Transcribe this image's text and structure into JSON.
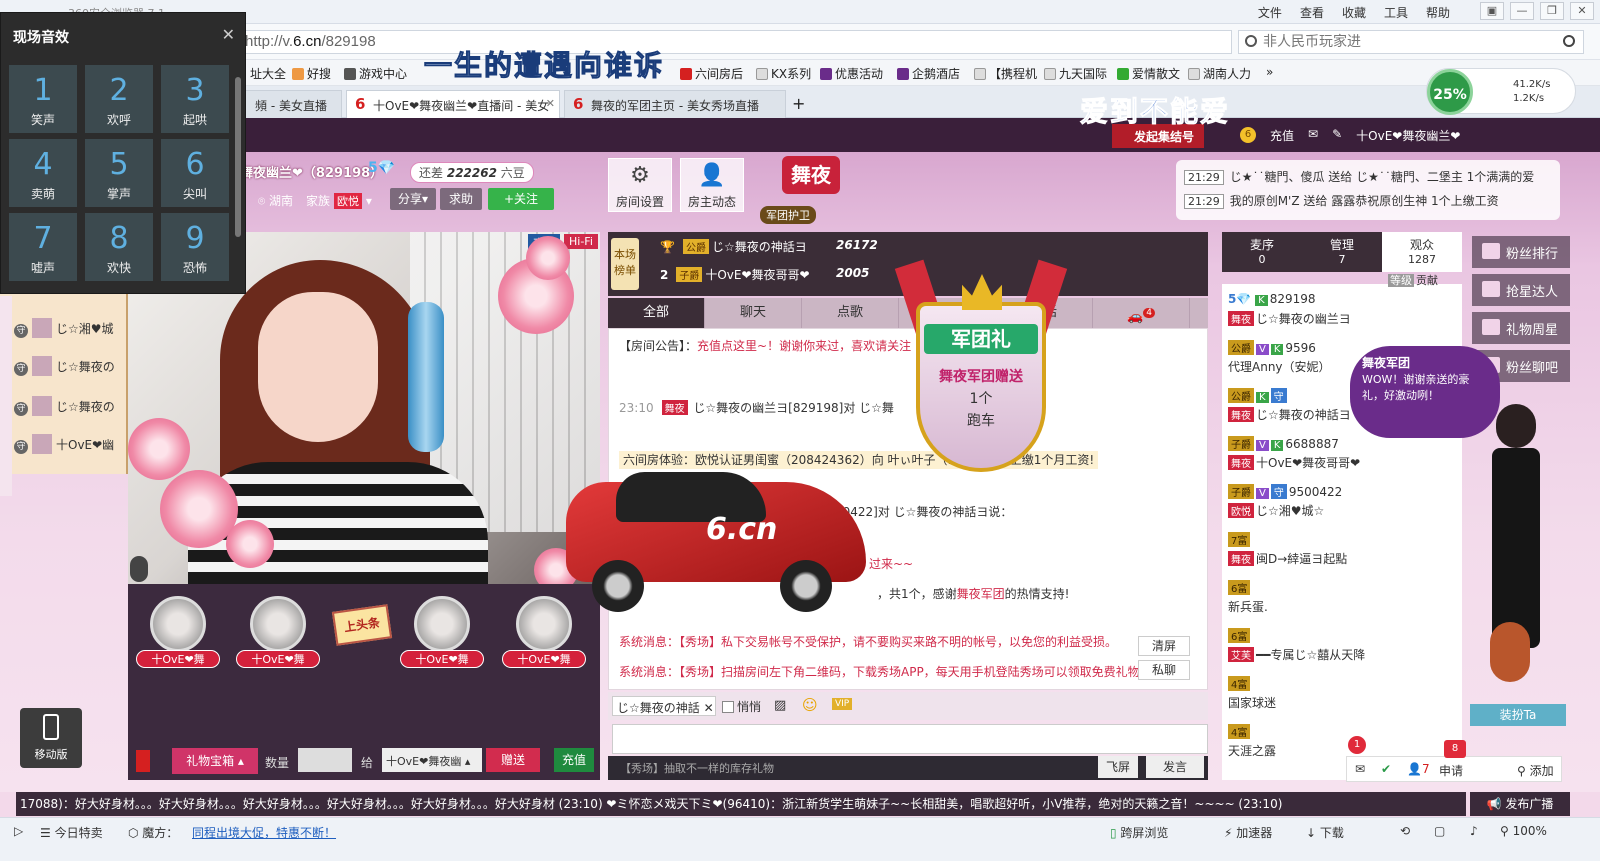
{
  "browser": {
    "title": "360安全浏览器 7.1",
    "menus": [
      "文件",
      "查看",
      "收藏",
      "工具",
      "帮助"
    ],
    "window_buttons": [
      "▣",
      "—",
      "❐",
      "✕"
    ],
    "address_prefix": "http://v.",
    "address_domain": "6.cn",
    "address_path": "/829198",
    "search_placeholder": "非人民币玩家进",
    "bookmarks": [
      "址大全",
      "好搜",
      "游戏中心",
      "六间房后",
      "KX系列",
      "优惠活动",
      "企鹅酒店",
      "【携程机",
      "九天国际",
      "爱情散文",
      "湖南人力"
    ],
    "bookmark_more": "»",
    "tabs": [
      {
        "label": "頻 - 美女直播",
        "active": false
      },
      {
        "label": "十OvE❤舞夜幽兰❤直播间 - 美女",
        "active": true
      },
      {
        "label": "舞夜的军团主页 - 美女秀场直播",
        "active": false
      }
    ],
    "new_tab": "+",
    "speed": {
      "percent": "25%",
      "up": "41.2K/s",
      "down": "1.2K/s"
    }
  },
  "overlay_banners": {
    "top": "一生的遭遇向谁诉",
    "right": "爱到不能爱"
  },
  "effects_panel": {
    "title": "现场音效",
    "close": "✕",
    "keys": [
      {
        "num": "1",
        "label": "笑声"
      },
      {
        "num": "2",
        "label": "欢呼"
      },
      {
        "num": "3",
        "label": "起哄"
      },
      {
        "num": "4",
        "label": "卖萌"
      },
      {
        "num": "5",
        "label": "掌声"
      },
      {
        "num": "6",
        "label": "尖叫"
      },
      {
        "num": "7",
        "label": "嘘声"
      },
      {
        "num": "8",
        "label": "欢快"
      },
      {
        "num": "9",
        "label": "恐怖"
      }
    ]
  },
  "site_header": {
    "rally_label": "发起集结号",
    "coin": "6",
    "recharge": "充值",
    "user": "十OvE❤舞夜幽兰❤"
  },
  "host": {
    "name": "舞夜幽兰❤（829198）",
    "level": "5💎",
    "still_label": "还差",
    "still_value": "222262",
    "still_unit": "六豆",
    "location": "湖南",
    "family_label": "家族",
    "family_badge": "欧悦",
    "share": "分享",
    "help": "求助",
    "follow": "+关注"
  },
  "room_buttons": [
    {
      "label": "房间设置",
      "glyph": "⚙"
    },
    {
      "label": "房主动态",
      "glyph": "👤"
    }
  ],
  "brand_logo": "舞夜",
  "guard_tag": "军团护卫",
  "ticker": [
    {
      "time": "21:29",
      "text": "じ★˙˙糖門、傻瓜 送给 じ★˙˙糖門、二堡主 1个满满的爱"
    },
    {
      "time": "21:29",
      "text": "我的原创M'Z 送给 露露恭祝原创生神 1个上缴工资"
    }
  ],
  "video": {
    "live": "直播",
    "hifi": "Hi-Fi"
  },
  "guard_list": [
    "じ☆湘♥城",
    "じ☆舞夜の",
    "じ☆舞夜の",
    "十OvE❤幽"
  ],
  "guard_shield": "守",
  "seats": [
    {
      "name": "十OvE❤舞"
    },
    {
      "name": "十OvE❤舞"
    },
    {
      "name": "十OvE❤舞"
    },
    {
      "name": "十OvE❤舞"
    }
  ],
  "head_sign": "上头条",
  "gift_bar": {
    "box": "礼物宝箱",
    "qty_label": "数量",
    "to_label": "给",
    "to_value": "十OvE❤舞夜幽",
    "send": "赠送",
    "recharge": "充值"
  },
  "mobile": "移动版",
  "rank": {
    "tag": "本场榜单",
    "rows": [
      {
        "num": "1",
        "badge": "公爵",
        "name": "じ☆舞夜の神話ヨ",
        "score": "26172"
      },
      {
        "num": "2",
        "badge": "子爵",
        "name": "十OvE❤舞夜哥哥❤",
        "score": "2005"
      }
    ]
  },
  "chat_tabs": [
    "全部",
    "聊天",
    "点歌",
    "礼物",
    "喊话",
    ""
  ],
  "chat_badge": "4",
  "chat": {
    "notice_label": "【房间公告】：",
    "notice_text": "充值点这里~！谢谢你来过，喜欢请关注",
    "msg1_time": "23:10",
    "msg1_text": "じ☆舞夜の幽兰ヨ[829198]对 じ☆舞",
    "msg2_text": "六间房体验：欧悦认证男闺蜜（208424362）向 叶ぃ叶子（…59955）上缴1个月工资!",
    "msg3_text": "[9500422]对 じ☆舞夜の神話ヨ说：",
    "msg4_text": "过来~~",
    "msg5_text": "，共1个，感谢",
    "msg5_link": "舞夜军团",
    "msg5_tail": "的热情支持!",
    "sys1": "系统消息：【秀场】私下交易帐号不受保护，请不要购买来路不明的帐号，以免您的利益受损。",
    "sys2": "系统消息：【秀场】扫描房间左下角二维码，下载秀场APP，每天用手机登陆秀场可以领取免费礼物哦",
    "clear": "清屏",
    "private": "私聊"
  },
  "legion_gift": {
    "title": "军团礼",
    "line1": "舞夜军团赠送",
    "line2": "1个",
    "line3": "跑车"
  },
  "chat_input": {
    "target": "じ☆舞夜の神話",
    "whisper": "悄悄",
    "footer_tip": "【秀场】抽取不一样的库存礼物",
    "fly": "飞屏",
    "send": "发言"
  },
  "user_tabs": [
    {
      "label": "麦序",
      "count": "0"
    },
    {
      "label": "管理",
      "count": "7"
    },
    {
      "label": "观众",
      "count": "1287"
    }
  ],
  "contrib": {
    "tag": "等级",
    "label": "贡献"
  },
  "users": [
    {
      "tags": [
        "5💎",
        "K"
      ],
      "id": "829198",
      "name": "じ☆舞夜の幽兰ヨ",
      "sub": "舞夜"
    },
    {
      "tags": [
        "公爵",
        "V",
        "K"
      ],
      "id": "9596",
      "name": "代理Anny（安妮）",
      "sub": ""
    },
    {
      "tags": [
        "公爵",
        "K",
        "守"
      ],
      "id": "",
      "name": "じ☆舞夜の神話ヨ",
      "sub": "舞夜"
    },
    {
      "tags": [
        "子爵",
        "V",
        "K"
      ],
      "id": "6688887",
      "name": "十OvE❤舞夜哥哥❤",
      "sub": "舞夜"
    },
    {
      "tags": [
        "子爵",
        "V",
        "守"
      ],
      "id": "9500422",
      "name": "じ☆湘♥城☆",
      "sub": "欧悦"
    },
    {
      "tags": [
        "7富"
      ],
      "id": "",
      "name": "闽D→緈逼ヨ起點",
      "sub": "舞夜"
    },
    {
      "tags": [
        "6富"
      ],
      "id": "",
      "name": "新兵蛋.",
      "sub": ""
    },
    {
      "tags": [
        "6富"
      ],
      "id": "",
      "name": "━━专属じ☆囍从天降",
      "sub": "艾芙"
    },
    {
      "tags": [
        "4富"
      ],
      "id": "",
      "name": "国家球迷",
      "sub": ""
    },
    {
      "tags": [
        "4富"
      ],
      "id": "",
      "name": "天涯之露",
      "sub": ""
    }
  ],
  "side_tools": [
    "粉丝排行",
    "抢星达人",
    "礼物周星",
    "粉丝聊吧"
  ],
  "bubble": {
    "title": "舞夜军团",
    "text": "WOW！谢谢亲送的豪礼，好激动咧！"
  },
  "dress_up": "装扮Ta",
  "notify": {
    "count1": "1",
    "count2": "8",
    "num": "7",
    "apply": "申请",
    "add": "添加"
  },
  "marquee": "17088)：好大好身材。。。好大好身材。。。好大好身材。。。好大好身材。。。好大好身材。。。好大好身材 (23:10)      ❤ミ怀恋メ戏天下ミ❤(96410)：浙江新货学生萌妹子~~长相甜美，唱歌超好听，小V推荐，绝对的天籁之音！~~~~ (23:10)",
  "broadcast": "发布广播",
  "statusbar": {
    "today": "今日特卖",
    "magic": "魔方：",
    "promo": "同程出境大促，特惠不断！",
    "cross": "跨屏浏览",
    "accel": "加速器",
    "download": "下载",
    "zoom": "100%"
  },
  "colors": {
    "brand": "#d52020",
    "accent_pink": "#d03468",
    "dark_panel": "#3b2d37",
    "follow_green": "#36b34a"
  }
}
